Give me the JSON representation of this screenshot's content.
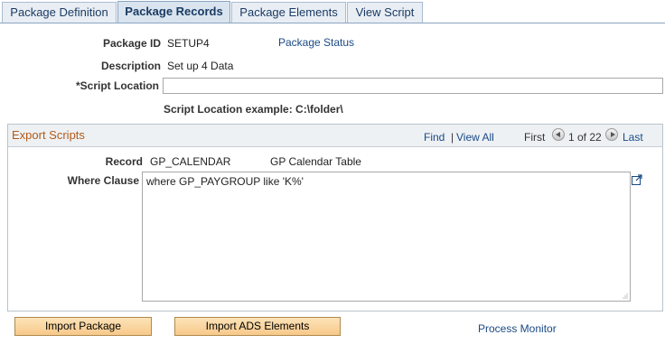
{
  "tabs": [
    {
      "label": "Package Definition"
    },
    {
      "label": "Package Records"
    },
    {
      "label": "Package Elements"
    },
    {
      "label": "View Script"
    }
  ],
  "form": {
    "package_id_label": "Package ID",
    "package_id_value": "SETUP4",
    "package_status_link": "Package Status",
    "description_label": "Description",
    "description_value": "Set up 4 Data",
    "script_location_label": "*Script Location",
    "script_location_value": "",
    "script_location_example": "Script Location example: C:\\folder\\"
  },
  "export_scripts": {
    "title": "Export Scripts",
    "find": "Find",
    "separator": "|",
    "view_all": "View All",
    "first": "First",
    "range": "1 of 22",
    "last": "Last",
    "record_label": "Record",
    "record_value": "GP_CALENDAR",
    "record_desc": "GP Calendar Table",
    "where_label": "Where Clause",
    "where_value": "where  GP_PAYGROUP like 'K%'"
  },
  "buttons": {
    "import_package": "Import Package",
    "import_ads": "Import ADS Elements",
    "process_monitor": "Process Monitor"
  }
}
